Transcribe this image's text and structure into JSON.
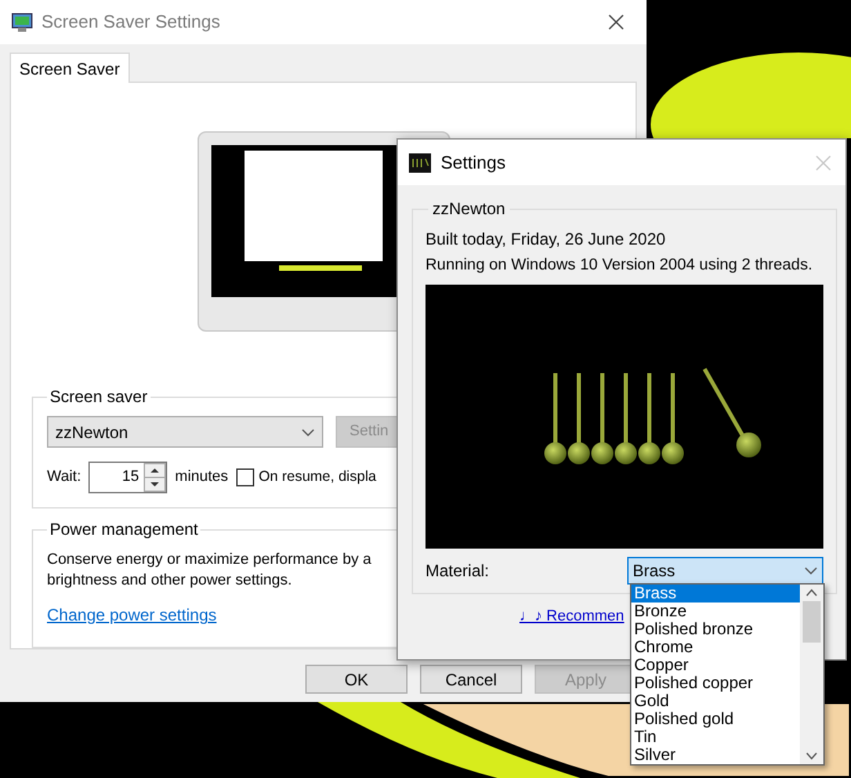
{
  "main_window": {
    "title": "Screen Saver Settings",
    "tabs": [
      {
        "label": "Screen Saver",
        "selected": true
      }
    ],
    "screen_saver": {
      "heading": "Screen saver",
      "selected_saver": "zzNewton",
      "settings_button": "Settin",
      "wait_label": "Wait:",
      "wait_value": "15",
      "wait_unit": "minutes",
      "on_resume": {
        "label": "On resume, displa",
        "checked": false
      }
    },
    "power_management": {
      "heading": "Power management",
      "lines": [
        "Conserve energy or maximize performance by a",
        "brightness and other power settings."
      ],
      "link": "Change power settings"
    },
    "buttons": [
      {
        "label": "OK",
        "disabled": false
      },
      {
        "label": "Cancel",
        "disabled": false
      },
      {
        "label": "Apply",
        "disabled": true
      }
    ]
  },
  "settings_window": {
    "title": "Settings",
    "group": "zzNewton",
    "lines": [
      "Built today, Friday, 26 June 2020",
      "Running on Windows 10 Version 2004 using 2 threads."
    ],
    "material_label": "Material:",
    "material_value": "Brass",
    "material_options": [
      {
        "label": "Brass",
        "selected": true
      },
      {
        "label": "Bronze",
        "selected": false
      },
      {
        "label": "Polished bronze",
        "selected": false
      },
      {
        "label": "Chrome",
        "selected": false
      },
      {
        "label": "Copper",
        "selected": false
      },
      {
        "label": "Polished copper",
        "selected": false
      },
      {
        "label": "Gold",
        "selected": false
      },
      {
        "label": "Polished gold",
        "selected": false
      },
      {
        "label": "Tin",
        "selected": false
      },
      {
        "label": "Silver",
        "selected": false
      }
    ],
    "link": "♩♪ Recommen"
  }
}
